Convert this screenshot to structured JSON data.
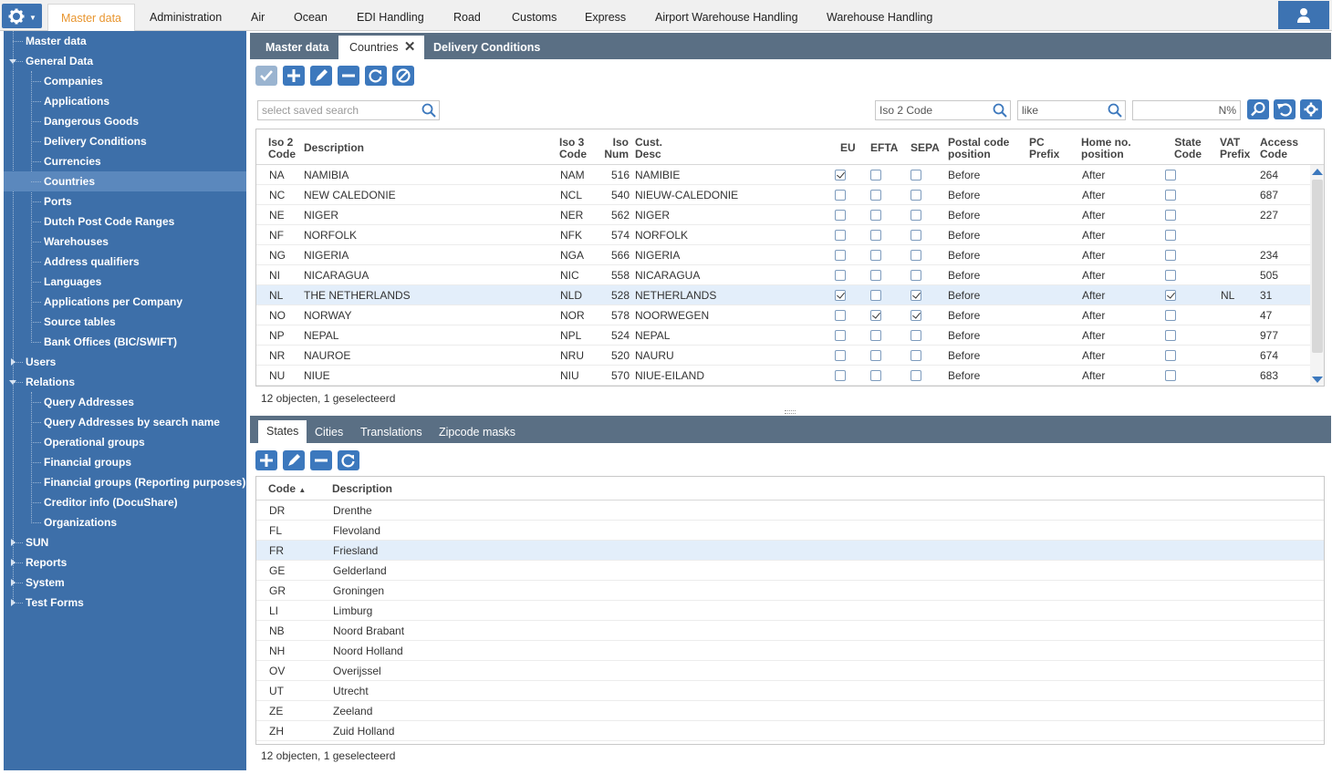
{
  "topbar": {
    "menus": [
      "Master data",
      "Administration",
      "Air",
      "Ocean",
      "EDI Handling",
      "Road",
      "Customs",
      "Express",
      "Airport Warehouse Handling",
      "Warehouse Handling"
    ],
    "active_menu": "Master data"
  },
  "sidebar": {
    "items": [
      {
        "label": "Master data",
        "level": 0
      },
      {
        "label": "General Data",
        "level": 0,
        "toggle": "open"
      },
      {
        "label": "Companies",
        "level": 1
      },
      {
        "label": "Applications",
        "level": 1
      },
      {
        "label": "Dangerous Goods",
        "level": 1
      },
      {
        "label": "Delivery Conditions",
        "level": 1
      },
      {
        "label": "Currencies",
        "level": 1
      },
      {
        "label": "Countries",
        "level": 1,
        "selected": true
      },
      {
        "label": "Ports",
        "level": 1
      },
      {
        "label": "Dutch Post Code Ranges",
        "level": 1
      },
      {
        "label": "Warehouses",
        "level": 1
      },
      {
        "label": "Address qualifiers",
        "level": 1
      },
      {
        "label": "Languages",
        "level": 1
      },
      {
        "label": "Applications per Company",
        "level": 1
      },
      {
        "label": "Source tables",
        "level": 1
      },
      {
        "label": "Bank Offices (BIC/SWIFT)",
        "level": 1
      },
      {
        "label": "Users",
        "level": 0,
        "toggle": "closed"
      },
      {
        "label": "Relations",
        "level": 0,
        "toggle": "open"
      },
      {
        "label": "Query Addresses",
        "level": 1
      },
      {
        "label": "Query Addresses by search name",
        "level": 1
      },
      {
        "label": "Operational groups",
        "level": 1
      },
      {
        "label": "Financial groups",
        "level": 1
      },
      {
        "label": "Financial groups (Reporting purposes)",
        "level": 1
      },
      {
        "label": "Creditor info (DocuShare)",
        "level": 1
      },
      {
        "label": "Organizations",
        "level": 1
      },
      {
        "label": "SUN",
        "level": 0,
        "toggle": "closed"
      },
      {
        "label": "Reports",
        "level": 0,
        "toggle": "closed"
      },
      {
        "label": "System",
        "level": 0,
        "toggle": "closed"
      },
      {
        "label": "Test Forms",
        "level": 0,
        "toggle": "closed"
      }
    ]
  },
  "tabs": {
    "t0": "Master data",
    "t1": "Countries",
    "t2": "Delivery Conditions"
  },
  "search": {
    "saved_placeholder": "select saved search",
    "field": "Iso 2 Code",
    "operator": "like",
    "value": "N%"
  },
  "countries": {
    "headers": {
      "iso2": "Iso 2\nCode",
      "desc": "Description",
      "iso3": "Iso 3\nCode",
      "isonum": "Iso\nNum",
      "cust": "Cust.\nDesc",
      "eu": "EU",
      "efta": "EFTA",
      "sepa": "SEPA",
      "pcpos": "Postal code\nposition",
      "pcprefix": "PC\nPrefix",
      "homeno": "Home no.\nposition",
      "state": "State\nCode",
      "vat": "VAT\nPrefix",
      "access": "Access\nCode"
    },
    "rows": [
      {
        "iso2": "NA",
        "desc": "NAMIBIA",
        "iso3": "NAM",
        "num": "516",
        "cust": "NAMIBIE",
        "eu": true,
        "efta": false,
        "sepa": false,
        "pcpos": "Before",
        "pcprefix": "",
        "home": "After",
        "state": false,
        "vat": "",
        "access": "264"
      },
      {
        "iso2": "NC",
        "desc": "NEW CALEDONIE",
        "iso3": "NCL",
        "num": "540",
        "cust": "NIEUW-CALEDONIE",
        "eu": false,
        "efta": false,
        "sepa": false,
        "pcpos": "Before",
        "pcprefix": "",
        "home": "After",
        "state": false,
        "vat": "",
        "access": "687"
      },
      {
        "iso2": "NE",
        "desc": "NIGER",
        "iso3": "NER",
        "num": "562",
        "cust": "NIGER",
        "eu": false,
        "efta": false,
        "sepa": false,
        "pcpos": "Before",
        "pcprefix": "",
        "home": "After",
        "state": false,
        "vat": "",
        "access": "227"
      },
      {
        "iso2": "NF",
        "desc": "NORFOLK",
        "iso3": "NFK",
        "num": "574",
        "cust": "NORFOLK",
        "eu": false,
        "efta": false,
        "sepa": false,
        "pcpos": "Before",
        "pcprefix": "",
        "home": "After",
        "state": false,
        "vat": "",
        "access": ""
      },
      {
        "iso2": "NG",
        "desc": "NIGERIA",
        "iso3": "NGA",
        "num": "566",
        "cust": "NIGERIA",
        "eu": false,
        "efta": false,
        "sepa": false,
        "pcpos": "Before",
        "pcprefix": "",
        "home": "After",
        "state": false,
        "vat": "",
        "access": "234"
      },
      {
        "iso2": "NI",
        "desc": "NICARAGUA",
        "iso3": "NIC",
        "num": "558",
        "cust": "NICARAGUA",
        "eu": false,
        "efta": false,
        "sepa": false,
        "pcpos": "Before",
        "pcprefix": "",
        "home": "After",
        "state": false,
        "vat": "",
        "access": "505"
      },
      {
        "iso2": "NL",
        "desc": "THE NETHERLANDS",
        "iso3": "NLD",
        "num": "528",
        "cust": "NETHERLANDS",
        "eu": true,
        "efta": false,
        "sepa": true,
        "pcpos": "Before",
        "pcprefix": "",
        "home": "After",
        "state": true,
        "vat": "NL",
        "access": "31",
        "selected": true
      },
      {
        "iso2": "NO",
        "desc": "NORWAY",
        "iso3": "NOR",
        "num": "578",
        "cust": "NOORWEGEN",
        "eu": false,
        "efta": true,
        "sepa": true,
        "pcpos": "Before",
        "pcprefix": "",
        "home": "After",
        "state": false,
        "vat": "",
        "access": "47"
      },
      {
        "iso2": "NP",
        "desc": "NEPAL",
        "iso3": "NPL",
        "num": "524",
        "cust": "NEPAL",
        "eu": false,
        "efta": false,
        "sepa": false,
        "pcpos": "Before",
        "pcprefix": "",
        "home": "After",
        "state": false,
        "vat": "",
        "access": "977"
      },
      {
        "iso2": "NR",
        "desc": "NAUROE",
        "iso3": "NRU",
        "num": "520",
        "cust": "NAURU",
        "eu": false,
        "efta": false,
        "sepa": false,
        "pcpos": "Before",
        "pcprefix": "",
        "home": "After",
        "state": false,
        "vat": "",
        "access": "674"
      },
      {
        "iso2": "NU",
        "desc": "NIUE",
        "iso3": "NIU",
        "num": "570",
        "cust": "NIUE-EILAND",
        "eu": false,
        "efta": false,
        "sepa": false,
        "pcpos": "Before",
        "pcprefix": "",
        "home": "After",
        "state": false,
        "vat": "",
        "access": "683"
      }
    ],
    "status": "12 objecten, 1 geselecteerd"
  },
  "subtabs": {
    "t0": "States",
    "t1": "Cities",
    "t2": "Translations",
    "t3": "Zipcode masks"
  },
  "states": {
    "headers": {
      "code": "Code",
      "desc": "Description"
    },
    "rows": [
      {
        "code": "DR",
        "desc": "Drenthe"
      },
      {
        "code": "FL",
        "desc": "Flevoland"
      },
      {
        "code": "FR",
        "desc": "Friesland",
        "selected": true
      },
      {
        "code": "GE",
        "desc": "Gelderland"
      },
      {
        "code": "GR",
        "desc": "Groningen"
      },
      {
        "code": "LI",
        "desc": "Limburg"
      },
      {
        "code": "NB",
        "desc": "Noord Brabant"
      },
      {
        "code": "NH",
        "desc": "Noord Holland"
      },
      {
        "code": "OV",
        "desc": "Overijssel"
      },
      {
        "code": "UT",
        "desc": "Utrecht"
      },
      {
        "code": "ZE",
        "desc": "Zeeland"
      },
      {
        "code": "ZH",
        "desc": "Zuid Holland"
      }
    ],
    "status": "12 objecten, 1 geselecteerd"
  },
  "colors": {
    "sidebar": "#3d6fa9",
    "tabbar": "#5a6f84",
    "accent": "#e8952e",
    "button": "#3c78bd"
  }
}
